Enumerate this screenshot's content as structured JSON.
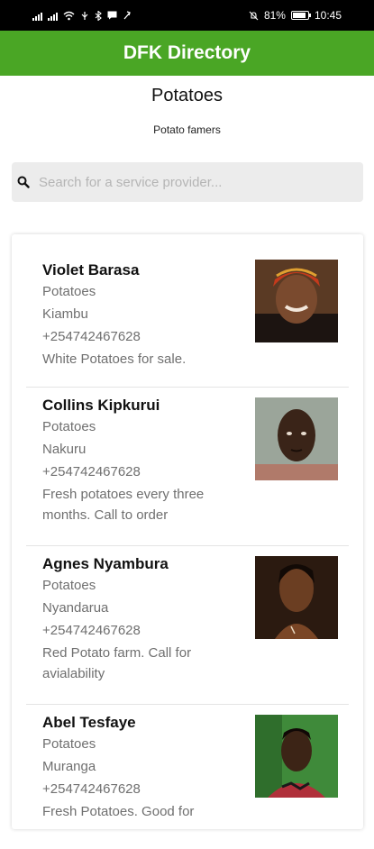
{
  "status_bar": {
    "battery": "81%",
    "time": "10:45"
  },
  "app_bar": {
    "title": "DFK Directory"
  },
  "page": {
    "title": "Potatoes",
    "subtitle": "Potato famers"
  },
  "search": {
    "placeholder": "Search for a service provider..."
  },
  "providers": [
    {
      "name": "Violet Barasa",
      "category": "Potatoes",
      "location": "Kiambu",
      "phone": "+254742467628",
      "description": "White Potatoes for sale."
    },
    {
      "name": "Collins Kipkurui",
      "category": "Potatoes",
      "location": "Nakuru",
      "phone": "+254742467628",
      "description": "Fresh potatoes every three months. Call to order"
    },
    {
      "name": "Agnes Nyambura",
      "category": "Potatoes",
      "location": "Nyandarua",
      "phone": "+254742467628",
      "description": "Red Potato farm. Call for avialability"
    },
    {
      "name": "Abel Tesfaye",
      "category": "Potatoes",
      "location": "Muranga",
      "phone": "+254742467628",
      "description": "Fresh Potatoes. Good for"
    }
  ],
  "colors": {
    "app_bar": "#4aa625",
    "status_bar": "#000000",
    "secondary_text": "#6f6f6f"
  }
}
